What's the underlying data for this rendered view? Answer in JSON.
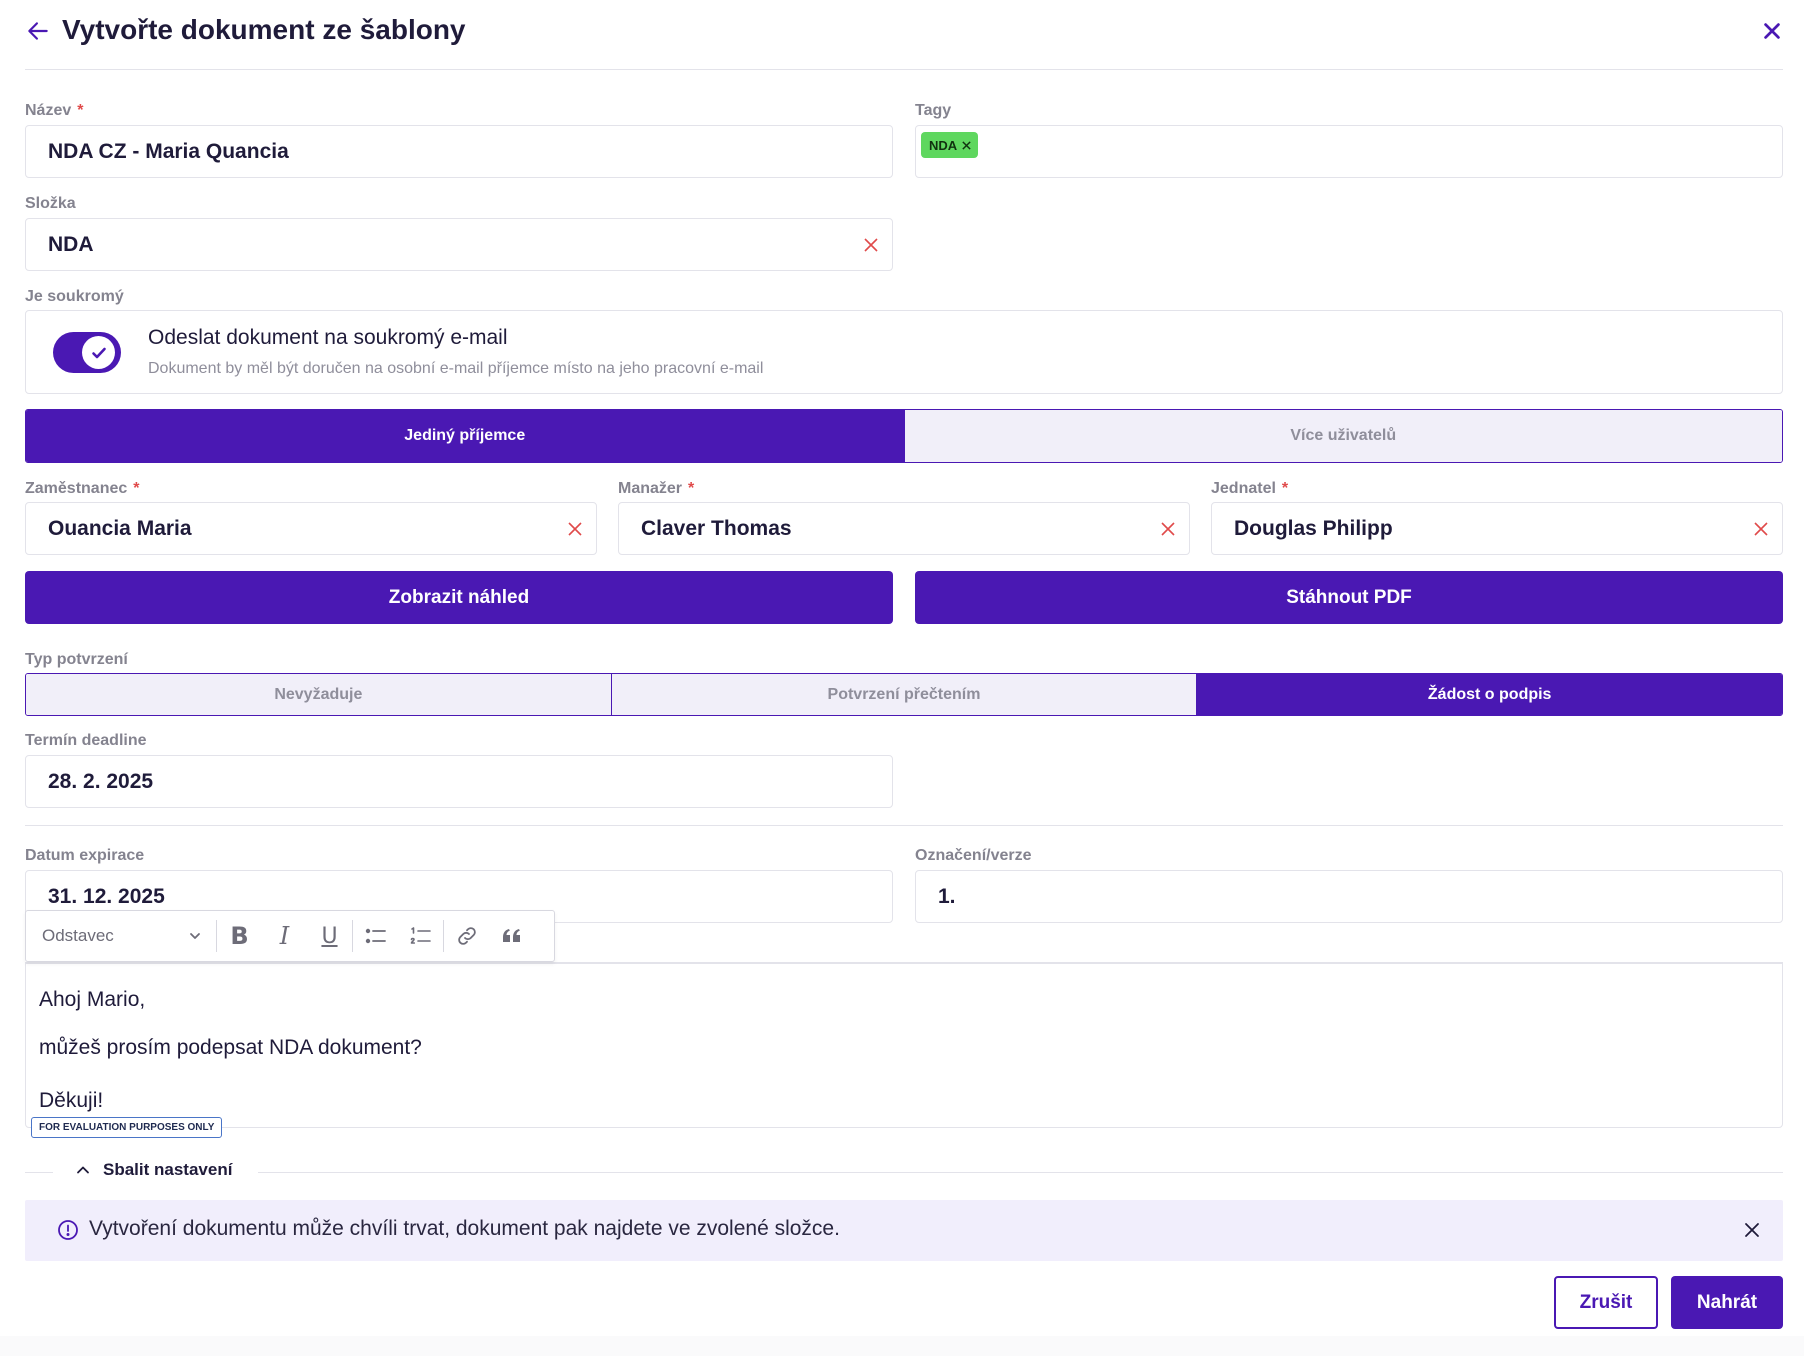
{
  "header": {
    "title": "Vytvořte dokument ze šablony",
    "back_icon": "arrow-left-icon",
    "close_icon": "close-icon"
  },
  "fields": {
    "name": {
      "label": "Název",
      "required_mark": "*",
      "value": "NDA CZ - Maria Quancia"
    },
    "tags": {
      "label": "Tagy",
      "items": [
        {
          "label": "NDA",
          "color": "#5fd75f"
        }
      ]
    },
    "folder": {
      "label": "Složka",
      "value": "NDA"
    },
    "private": {
      "label": "Je soukromý",
      "toggle_on": true,
      "title": "Odeslat dokument na soukromý e-mail",
      "description": "Dokument by měl být doručen na osobní e-mail příjemce místo na jeho pracovní e-mail"
    }
  },
  "recipient_mode": {
    "options": [
      "Jediný příjemce",
      "Více uživatelů"
    ],
    "selected": "Jediný příjemce"
  },
  "people": {
    "employee": {
      "label": "Zaměstnanec",
      "value": "Ouancia Maria"
    },
    "manager": {
      "label": "Manažer",
      "value": "Claver Thomas"
    },
    "executive": {
      "label": "Jednatel",
      "value": "Douglas Philipp"
    }
  },
  "actions": {
    "preview": "Zobrazit náhled",
    "download": "Stáhnout PDF"
  },
  "confirmation": {
    "label": "Typ potvrzení",
    "options": [
      "Nevyžaduje",
      "Potvrzení přečtením",
      "Žádost o podpis"
    ],
    "selected": "Žádost o podpis"
  },
  "deadline": {
    "label": "Termín deadline",
    "value": "28. 2. 2025"
  },
  "expiration": {
    "label": "Datum expirace",
    "value": "31. 12. 2025"
  },
  "version": {
    "label": "Označení/verze",
    "value": "1."
  },
  "editor": {
    "toolbar": {
      "paragraph_style": "Odstavec",
      "bold": "B",
      "italic": "I",
      "underline": "U"
    },
    "lines": [
      "Ahoj Mario,",
      "můžeš prosím podepsat NDA dokument?",
      "Děkuji!"
    ],
    "watermark": "FOR EVALUATION PURPOSES ONLY"
  },
  "collapse": {
    "label": "Sbalit nastavení"
  },
  "info": {
    "text": "Vytvoření dokumentu může chvíli trvat, dokument pak najdete ve zvolené složce."
  },
  "footer": {
    "cancel": "Zrušit",
    "submit": "Nahrát"
  },
  "colors": {
    "accent": "#4a18b3",
    "required": "#e04a4a",
    "tag": "#5fd75f",
    "info_bg": "#f1eefc"
  }
}
